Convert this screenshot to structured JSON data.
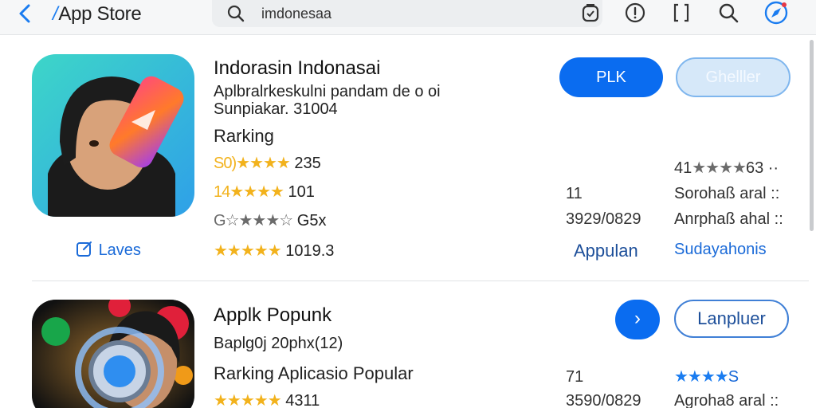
{
  "topbar": {
    "app_title_mark": "/",
    "app_title": "App Store",
    "search": {
      "value": "imdonesaa",
      "placeholder": ""
    },
    "icons": [
      "back-icon",
      "search-icon",
      "clipboard-icon",
      "info-icon",
      "bracket-icon",
      "search-icon",
      "compass-icon"
    ]
  },
  "apps": [
    {
      "name": "Indorasin Indonasai",
      "description": "Aplbralrkeskulni pandam de o oi",
      "meta": "Sunpiakar. 31004",
      "ranking_label": "Rarking",
      "ratings": [
        {
          "prefix": "S0)",
          "stars": "★★★★",
          "value": "235",
          "style": "gold"
        },
        {
          "prefix": "14",
          "stars": "★★★★",
          "value": "101",
          "style": "gold"
        },
        {
          "prefix": "G",
          "stars": "☆★★★☆",
          "value": "G5x",
          "style": "grey"
        },
        {
          "prefix": "",
          "stars": "★★★★★",
          "value": "1019.3",
          "style": "gold"
        }
      ],
      "link_label": "Laves",
      "primary_button": "PLK",
      "secondary_button": "Ghelller",
      "right_rating": {
        "prefix": "41",
        "stars": "★★★★",
        "suffix": "63 ··"
      },
      "right_rows": [
        {
          "left": "11",
          "right": "Sorohaß aral ::"
        },
        {
          "left": "3929/0829",
          "right": "Anrphaß ahal ::"
        },
        {
          "left": "Appulan",
          "right": "Sudayahonis"
        }
      ],
      "colors": {
        "icon_bg_start": "#3dd6c8",
        "icon_bg_end": "#2fa0e8"
      }
    },
    {
      "name": "Applk Popunk",
      "description": "Baplg0j 20phx(12)",
      "ranking_label": "Rarking Aplicasio Popular",
      "ratings": [
        {
          "prefix": "",
          "stars": "★★★★★",
          "value": "4311",
          "style": "gold"
        }
      ],
      "primary_button": "›",
      "secondary_button": "Lanpluer",
      "right_rating": {
        "prefix": "",
        "stars": "★★★★",
        "suffix": "S"
      },
      "right_rows": [
        {
          "left": "71",
          "right": ""
        },
        {
          "left": "3590/0829",
          "right": "Agroha8 aral ::"
        }
      ]
    }
  ],
  "colors": {
    "accent": "#0a6cf0",
    "star_gold": "#f2b21c"
  }
}
